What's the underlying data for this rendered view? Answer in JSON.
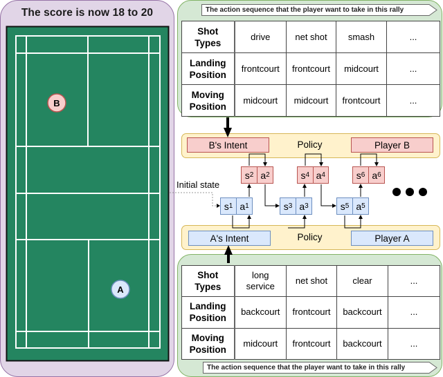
{
  "court_panel": {
    "title": "The score is now 18 to 20",
    "players": [
      {
        "id": "B",
        "label": "B",
        "fill": "#f8cecc",
        "stroke": "#b85450"
      },
      {
        "id": "A",
        "label": "A",
        "fill": "#dae8fc",
        "stroke": "#6c8ebf"
      }
    ],
    "court_color": "#248560",
    "panel_color": "#e1d5e7"
  },
  "player_b_sequence": {
    "banner": "The action sequence that the player want to take in this rally",
    "rows": [
      {
        "header": [
          "Shot",
          "Types"
        ],
        "cells": [
          "drive",
          "net shot",
          "smash",
          "..."
        ]
      },
      {
        "header": [
          "Landing",
          "Position"
        ],
        "cells": [
          "frontcourt",
          "frontcourt",
          "midcourt",
          "..."
        ]
      },
      {
        "header": [
          "Moving",
          "Position"
        ],
        "cells": [
          "midcourt",
          "midcourt",
          "frontcourt",
          "..."
        ]
      }
    ]
  },
  "policy_b": {
    "intent_label": "B's Intent",
    "policy_label": "Policy",
    "player_label": "Player B"
  },
  "policy_a": {
    "intent_label": "A's Intent",
    "policy_label": "Policy",
    "player_label": "Player A"
  },
  "state_action_pairs": {
    "initial_state_label": "Initial state",
    "player_b": [
      {
        "s": "s",
        "s_sub": "2",
        "a": "a",
        "a_sub": "2"
      },
      {
        "s": "s",
        "s_sub": "4",
        "a": "a",
        "a_sub": "4"
      },
      {
        "s": "s",
        "s_sub": "6",
        "a": "a",
        "a_sub": "6"
      }
    ],
    "player_a": [
      {
        "s": "s",
        "s_sub": "1",
        "a": "a",
        "a_sub": "1"
      },
      {
        "s": "s",
        "s_sub": "3",
        "a": "a",
        "a_sub": "3"
      },
      {
        "s": "s",
        "s_sub": "5",
        "a": "a",
        "a_sub": "5"
      }
    ],
    "continuation": "ellipsis-dots"
  },
  "player_a_sequence": {
    "banner": "The action sequence that the player want to take in this rally",
    "rows": [
      {
        "header": [
          "Shot",
          "Types"
        ],
        "cells": [
          "long service",
          "net shot",
          "clear",
          "..."
        ]
      },
      {
        "header": [
          "Landing",
          "Position"
        ],
        "cells": [
          "backcourt",
          "frontcourt",
          "backcourt",
          "..."
        ]
      },
      {
        "header": [
          "Moving",
          "Position"
        ],
        "cells": [
          "midcourt",
          "frontcourt",
          "backcourt",
          "..."
        ]
      }
    ]
  }
}
